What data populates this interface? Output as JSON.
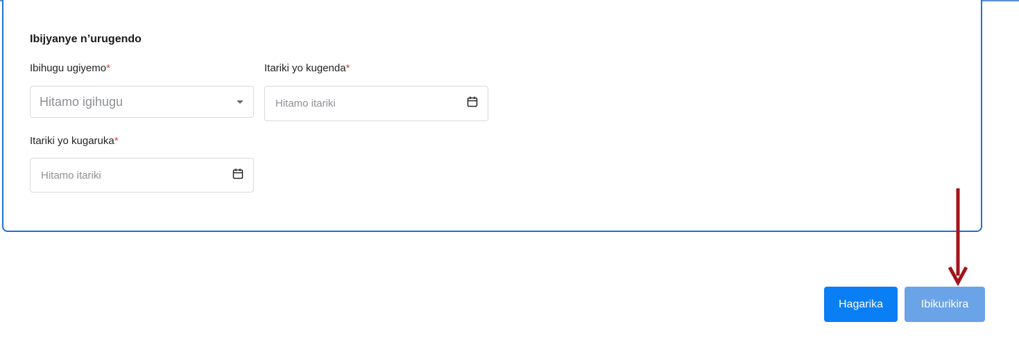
{
  "form": {
    "section_title": "Ibijyanye n’urugendo",
    "country": {
      "label": "Ibihugu ugiyemo",
      "required_mark": "*",
      "placeholder": "Hitamo igihugu"
    },
    "departure_date": {
      "label": "Itariki yo kugenda",
      "required_mark": "*",
      "placeholder": "Hitamo itariki"
    },
    "return_date": {
      "label": "Itariki yo kugaruka",
      "required_mark": "*",
      "placeholder": "Hitamo itariki"
    }
  },
  "actions": {
    "cancel_label": "Hagarika",
    "submit_label": "Ibikurikira"
  },
  "colors": {
    "card_border": "#1f6fd1",
    "required": "#e5383b",
    "cancel_button": "#0a7ef5",
    "submit_button": "#6aa3e8",
    "annotation_arrow": "#a3141b"
  },
  "icons": {
    "select_caret": "caret-down-icon",
    "date_picker": "calendar-icon",
    "annotation": "down-arrow-icon"
  }
}
